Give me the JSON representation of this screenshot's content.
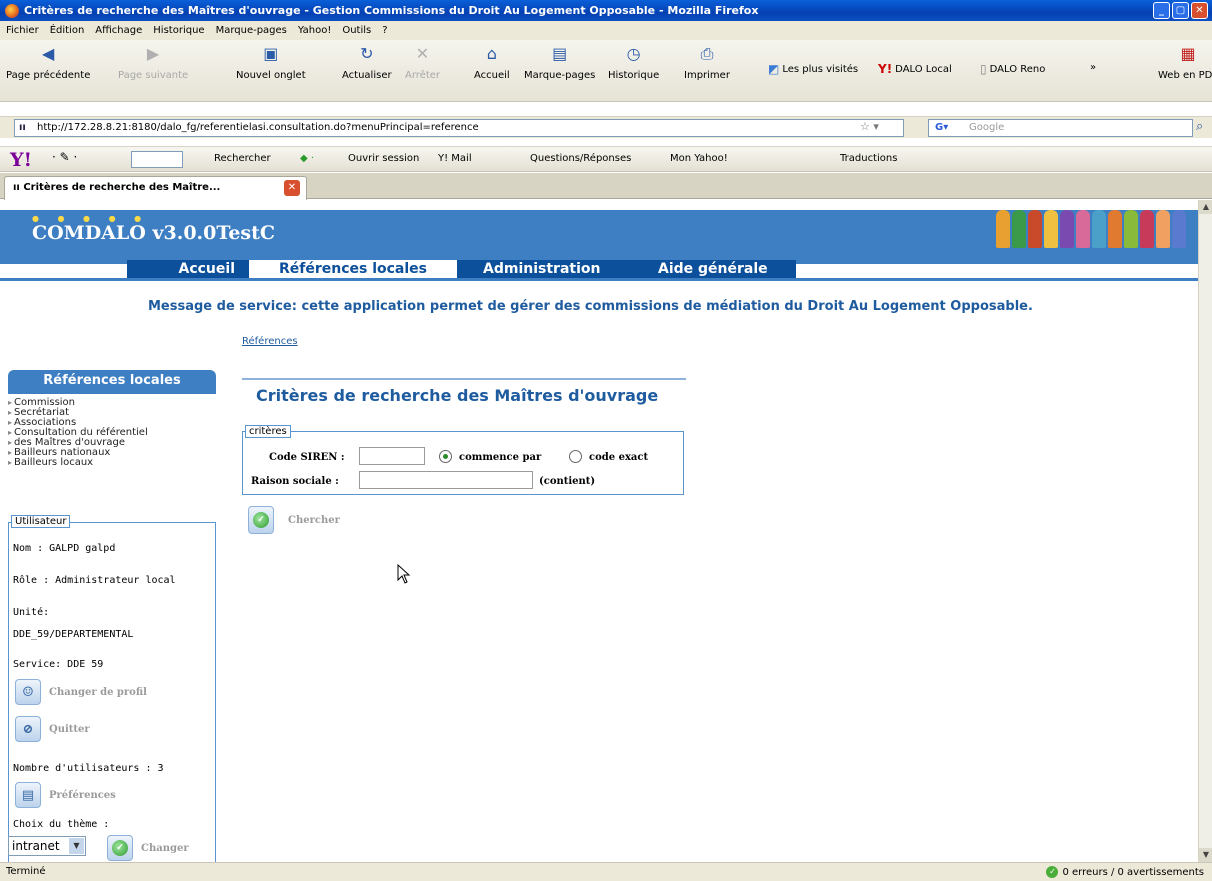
{
  "window": {
    "title": "Critères de recherche des Maîtres d'ouvrage - Gestion Commissions du Droit Au Logement Opposable - Mozilla Firefox"
  },
  "menubar": [
    "Fichier",
    "Édition",
    "Affichage",
    "Historique",
    "Marque-pages",
    "Yahoo!",
    "Outils",
    "?"
  ],
  "toolbar": {
    "back": "Page précédente",
    "forward": "Page suivante",
    "new_tab": "Nouvel onglet",
    "reload": "Actualiser",
    "stop": "Arrêter",
    "home": "Accueil",
    "bookmarks": "Marque-pages",
    "history": "Historique",
    "print": "Imprimer",
    "bookmark_links": [
      "Les plus visités",
      "DALO Local",
      "DALO Reno"
    ],
    "more": "»",
    "pdf": "Web en PDF"
  },
  "address": {
    "url": "http://172.28.8.21:8180/dalo_fg/referentielasi.consultation.do?menuPrincipal=reference",
    "search_placeholder": "Google"
  },
  "yahoo_toolbar": {
    "logo": "Y!",
    "items": [
      "Rechercher",
      "Ouvrir session",
      "Y! Mail",
      "Questions/Réponses",
      "Mon Yahoo!",
      "Traductions"
    ]
  },
  "tab": {
    "label": "Critères de recherche des Maître..."
  },
  "app": {
    "name": "COMDALO v3.0.0TestC",
    "nav": [
      "Accueil",
      "Références locales",
      "Administration",
      "Aide générale"
    ],
    "service_message": "Message de service: cette application permet de gérer des commissions de médiation du Droit Au Logement Opposable.",
    "breadcrumb": "Références"
  },
  "sidebar": {
    "header": "Références locales",
    "items": [
      "Commission",
      "Secrétariat",
      "Associations",
      "Consultation du référentiel",
      "des Maîtres d'ouvrage",
      "Bailleurs nationaux",
      "Bailleurs locaux"
    ],
    "user_box": {
      "legend": "Utilisateur",
      "name": "Nom : GALPD galpd",
      "role": "Rôle : Administrateur local",
      "unit_label": "Unité:",
      "unit_value": "DDE_59/DEPARTEMENTAL",
      "service": "Service: DDE 59",
      "change_profile": "Changer de profil",
      "quit": "Quitter",
      "user_count": "Nombre d'utilisateurs : 3",
      "preferences": "Préférences",
      "theme_label": "Choix du thème :",
      "theme_value": "intranet",
      "change": "Changer"
    }
  },
  "form": {
    "title": "Critères de recherche des Maîtres d'ouvrage",
    "legend": "critères",
    "siren_label": "Code SIREN :",
    "starts_with": "commence par",
    "exact_code": "code exact",
    "company_label": "Raison sociale :",
    "contains": "(contient)",
    "search_button": "Chercher"
  },
  "status": {
    "text": "Terminé",
    "errors": "0 erreurs / 0 avertissements"
  }
}
